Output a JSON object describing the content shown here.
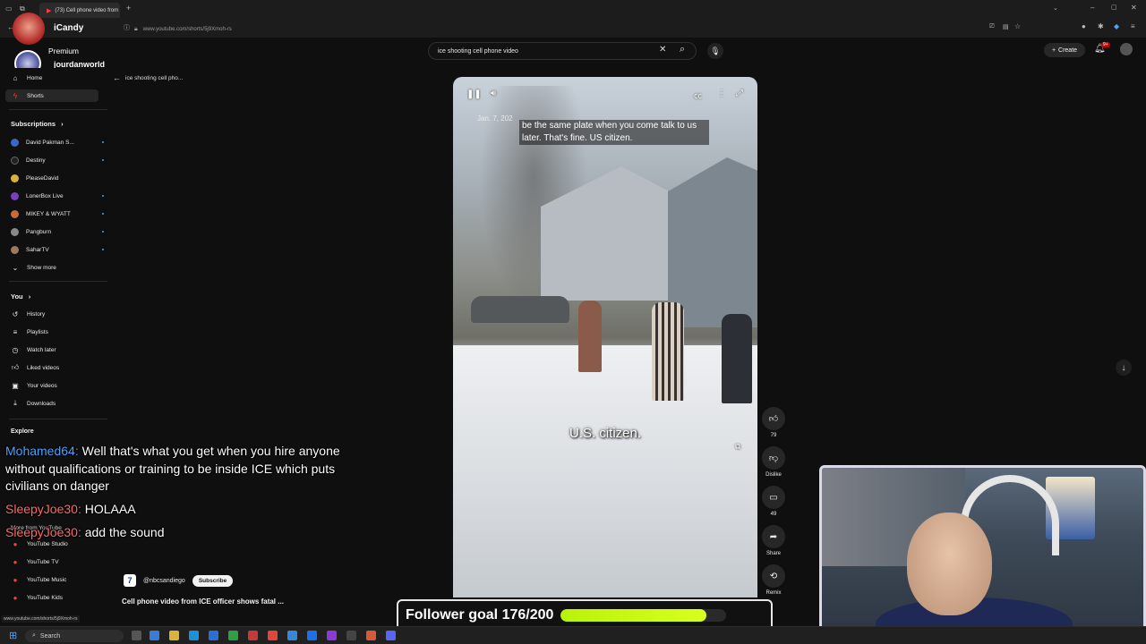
{
  "browser": {
    "tab_title": "(73) Cell phone video from",
    "url": "www.youtube.com/shorts/5j9Xmoh-rs",
    "status_url": "www.youtube.com/shorts/5j9Xmoh-rs"
  },
  "youtube": {
    "premium_label": "Premium",
    "search_value": "ice shooting cell phone video",
    "create_label": "Create",
    "notification_count": "9+",
    "back_label": "ice shooting cell pho..."
  },
  "overlay": {
    "brand": "iCandy",
    "username": "jourdanworld"
  },
  "sidebar": {
    "home": "Home",
    "shorts": "Shorts",
    "subscriptions_header": "Subscriptions",
    "subscriptions": [
      {
        "label": "David Pakman S...",
        "color": "#3a66c4"
      },
      {
        "label": "Destiny",
        "color": "#222222"
      },
      {
        "label": "PleaseDavid",
        "color": "#d8b23a"
      },
      {
        "label": "LonerBox Live",
        "color": "#7a3fb8"
      },
      {
        "label": "MIKEY & WYATT",
        "color": "#c96a3a"
      },
      {
        "label": "Pangburn",
        "color": "#888888"
      },
      {
        "label": "SaharTV",
        "color": "#9a7a5a"
      }
    ],
    "show_more": "Show more",
    "you_header": "You",
    "you_items": [
      "History",
      "Playlists",
      "Watch later",
      "Liked videos",
      "Your videos",
      "Downloads"
    ],
    "explore_header": "Explore",
    "more_from_youtube": "More from YouTube",
    "youtube_items": [
      "YouTube Studio",
      "YouTube TV",
      "YouTube Music",
      "YouTube Kids"
    ]
  },
  "video": {
    "date": "Jan. 7, 202",
    "caption_top": "be the same plate when you come talk to us later. That's fine. US citizen.",
    "caption_mid": "U.S. citizen."
  },
  "actions": {
    "likes": "79",
    "dislike": "Dislike",
    "comments": "49",
    "share": "Share",
    "remix": "Remix"
  },
  "chat": [
    {
      "user": "Mohamed64:",
      "color": "#4aa3ff",
      "message": "Well that's what you get when you hire anyone without qualifications or training to be inside ICE which puts civilians on danger"
    },
    {
      "user": "SleepyJoe30:",
      "color": "#ff6a6a",
      "message": "HOLAAA"
    },
    {
      "user": "SleepyJoe30:",
      "color": "#ff6a6a",
      "message": "add the sound"
    }
  ],
  "channel": {
    "handle": "@nbcsandiego",
    "subscribe": "Subscribe",
    "video_title": "Cell phone video from ICE officer shows fatal ..."
  },
  "follower_goal": {
    "label": "Follower goal 176/200",
    "current": 176,
    "target": 200
  },
  "taskbar": {
    "search": "Search"
  },
  "colors": {
    "background": "#0f0f0f",
    "goal_fill": "#c8f81a",
    "accent_red": "#ff0033"
  }
}
